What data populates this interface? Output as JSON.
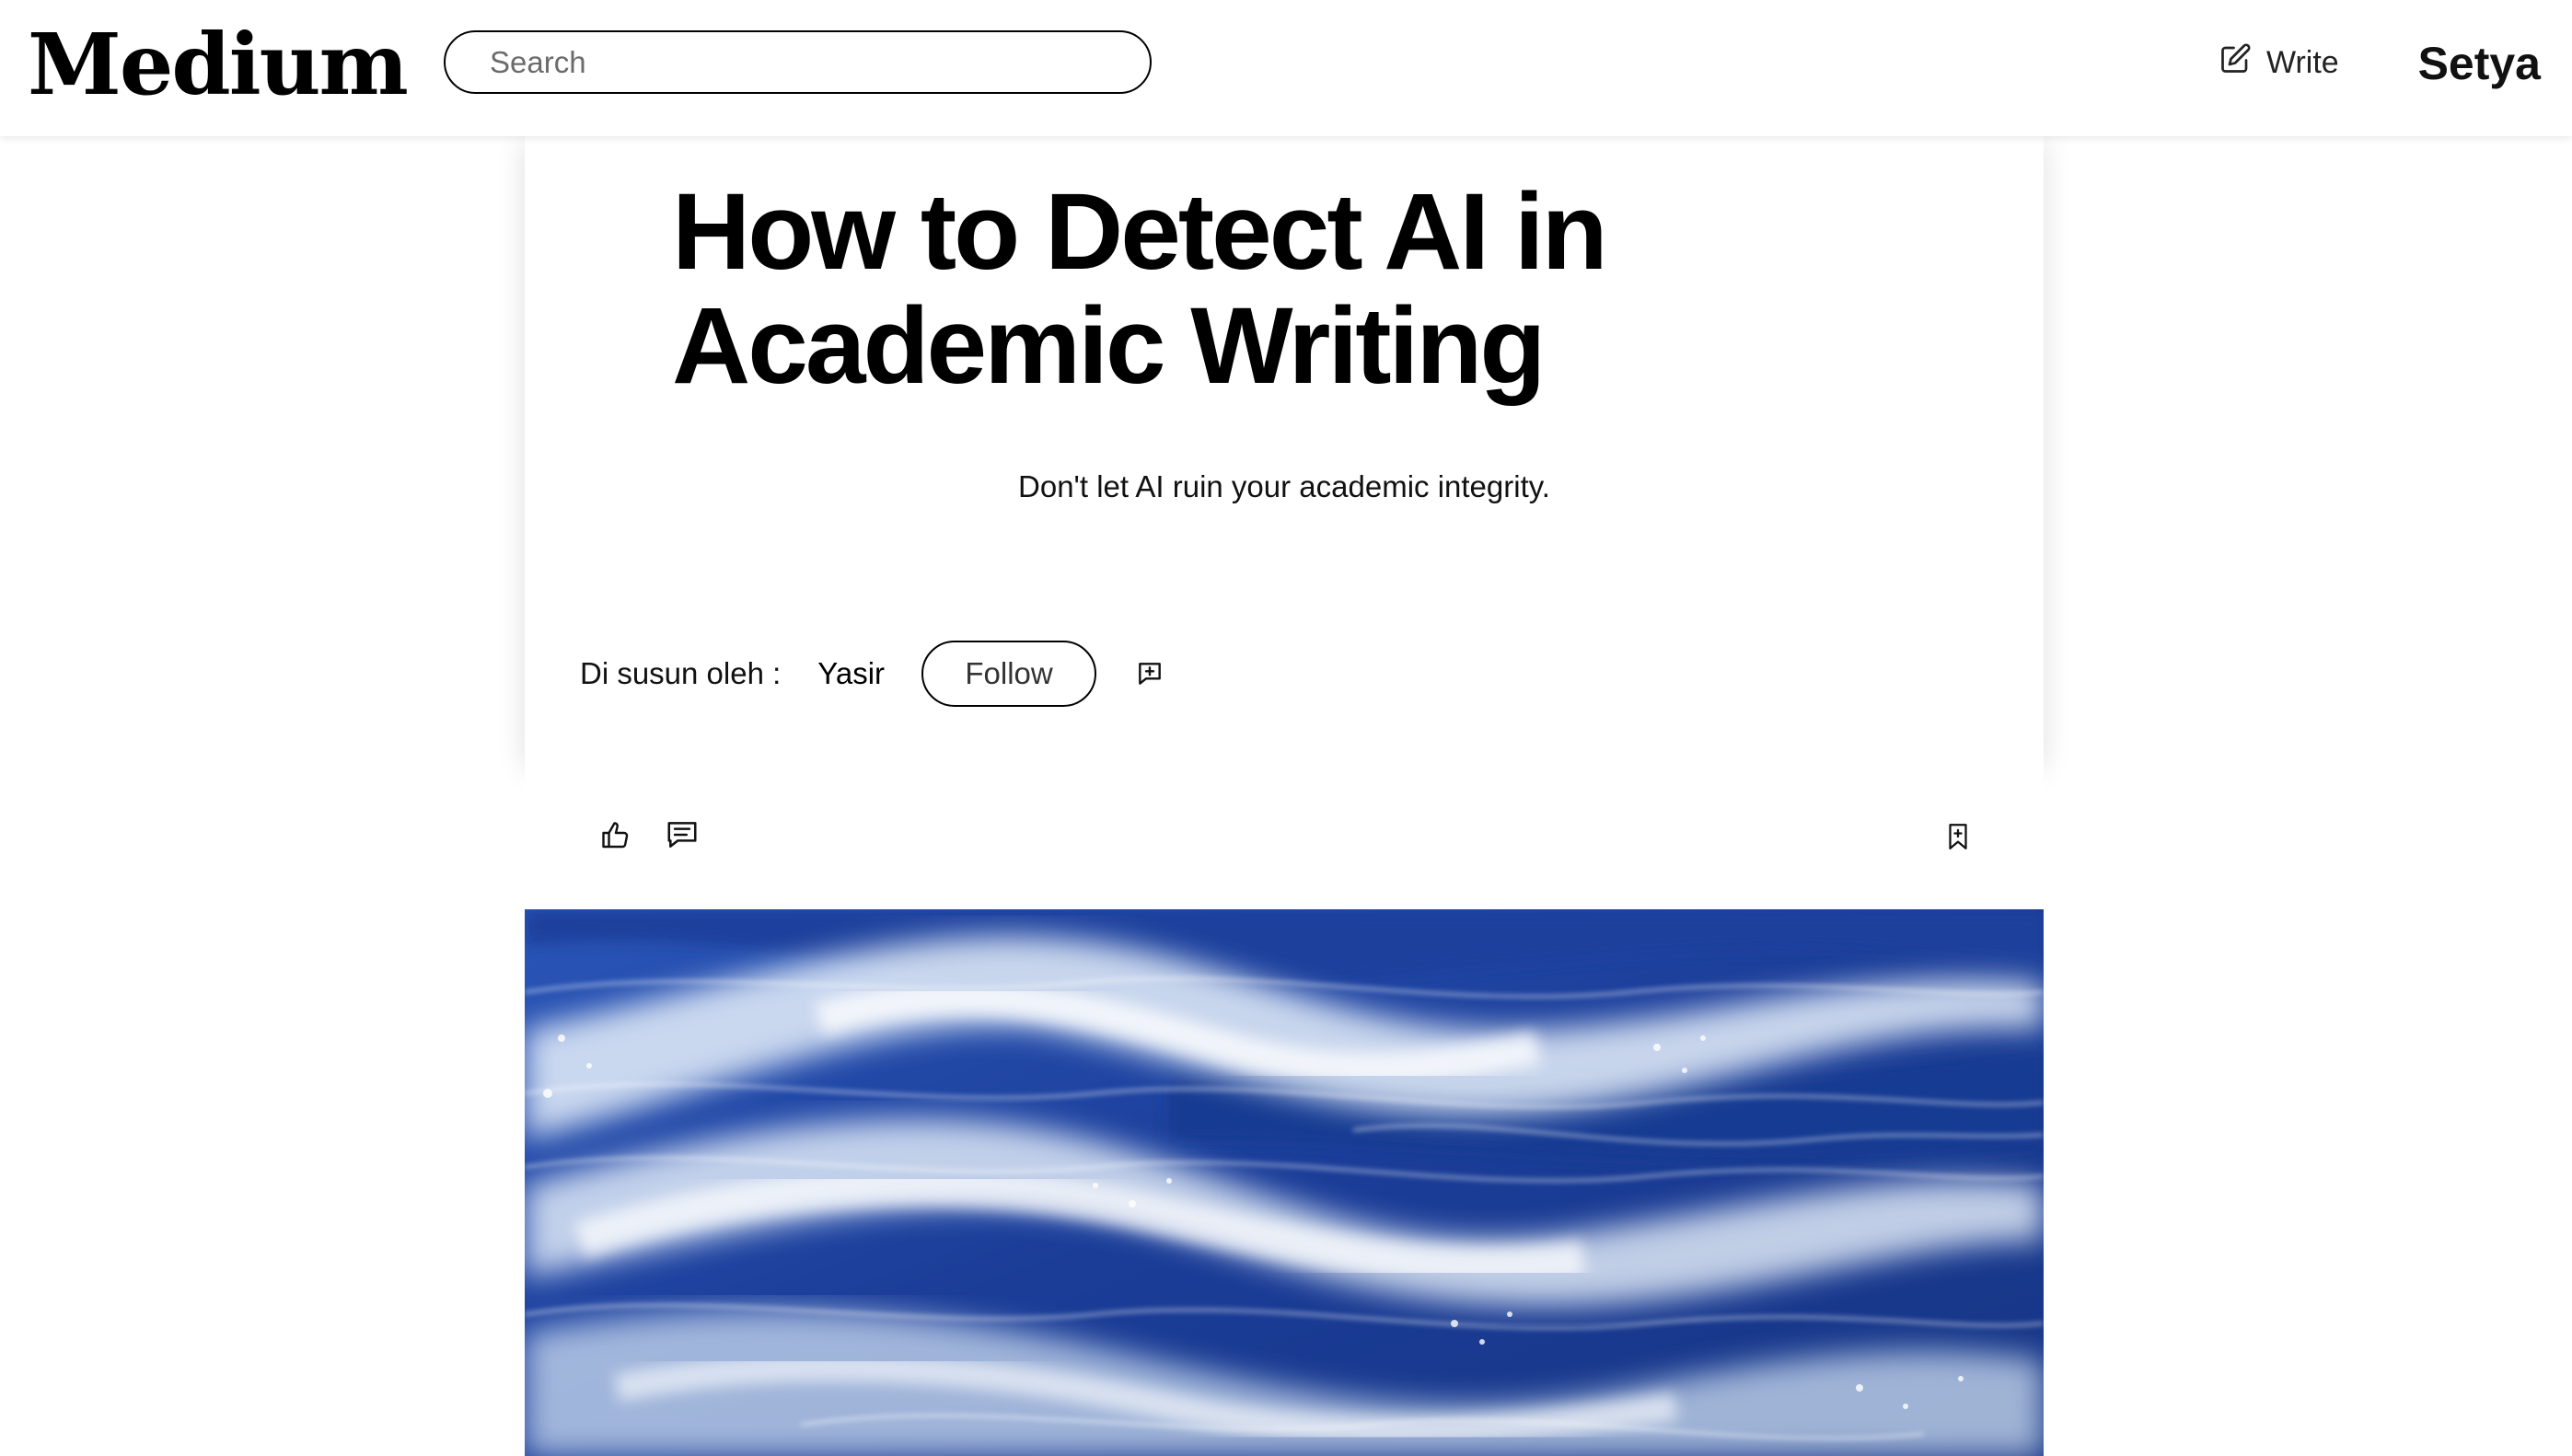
{
  "header": {
    "logo": "Medium",
    "search_placeholder": "Search",
    "write_label": "Write",
    "user_name": "Setya"
  },
  "article": {
    "title": "How to Detect AI in Academic Writing",
    "subtitle": "Don't let AI ruin your academic integrity.",
    "byline_label": "Di susun oleh :",
    "author": "Yasir",
    "follow_label": "Follow"
  },
  "actions": {
    "icons": [
      "thumbs-up-icon",
      "comment-icon",
      "bookmark-icon"
    ]
  },
  "hero": {
    "description_icon": "ocean-waves-image"
  },
  "colors": {
    "background": "#ffffff",
    "text": "#000000",
    "ocean_dark": "#1d3f99",
    "ocean_foam": "#e8f1fb"
  }
}
